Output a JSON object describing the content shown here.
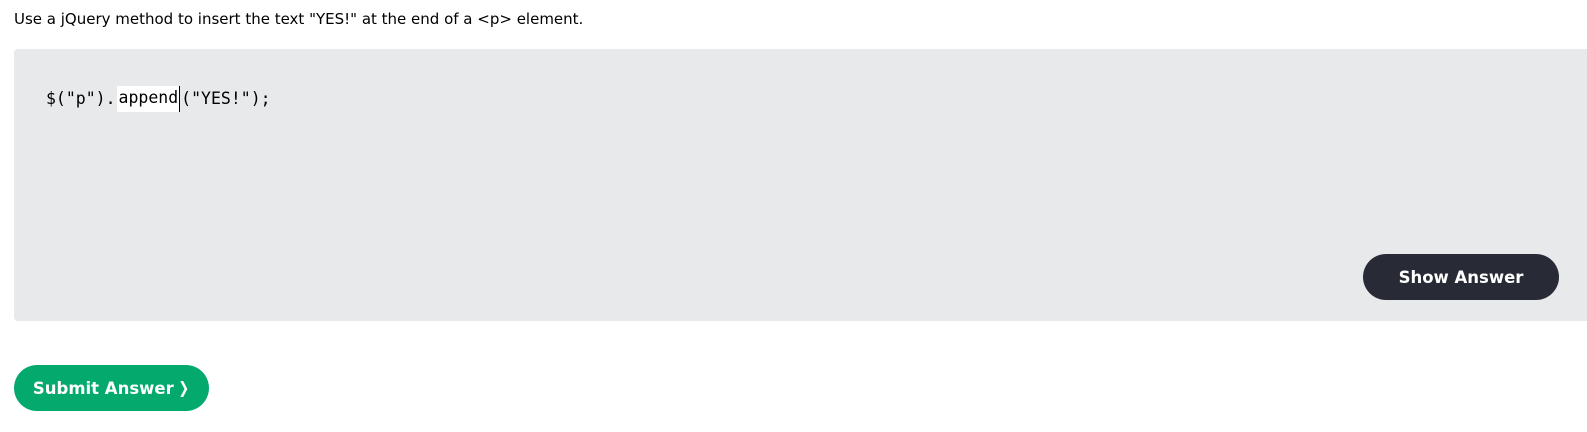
{
  "exercise": {
    "instruction": "Use a jQuery method to insert the text \"YES!\" at the end of a <p> element.",
    "code_prefix": "$(\"p\").",
    "input_value": "append",
    "code_suffix": "(\"YES!\");"
  },
  "buttons": {
    "show_answer_label": "Show Answer",
    "submit_answer_label": "Submit Answer",
    "submit_icon": "chevron-right-icon"
  },
  "colors": {
    "exercise_bg": "#e7e9eb",
    "show_answer_bg": "#282a35",
    "submit_bg": "#04aa6d"
  }
}
